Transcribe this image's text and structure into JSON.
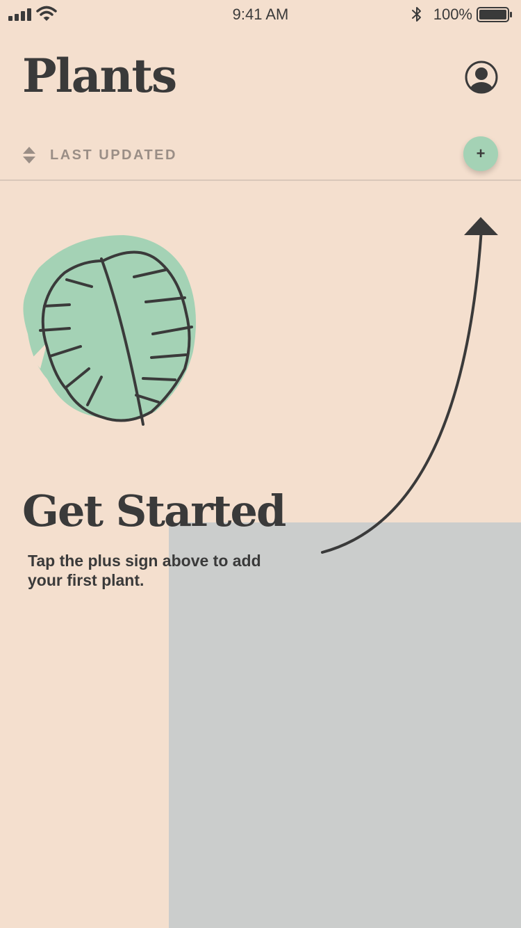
{
  "status_bar": {
    "time": "9:41 AM",
    "battery_percent": "100%",
    "signal_icon": "cellular-signal-icon",
    "wifi_icon": "wifi-icon",
    "bluetooth_icon": "bluetooth-icon",
    "battery_icon": "battery-icon"
  },
  "header": {
    "title": "Plants",
    "profile_icon": "user-profile-icon"
  },
  "sort_bar": {
    "label": "LAST UPDATED",
    "sort_icon": "sort-arrows-icon",
    "add_label": "+"
  },
  "empty_state": {
    "illustration_icon": "monstera-leaf-icon",
    "arrow_icon": "curved-arrow-icon",
    "title": "Get Started",
    "message": "Tap the plus sign above to add your first plant."
  },
  "colors": {
    "background": "#F4DFCE",
    "accent": "#A4D2B5",
    "text": "#3A3A3A",
    "muted_text": "#9A8E86",
    "overlay_panel": "#CBCDCC"
  }
}
